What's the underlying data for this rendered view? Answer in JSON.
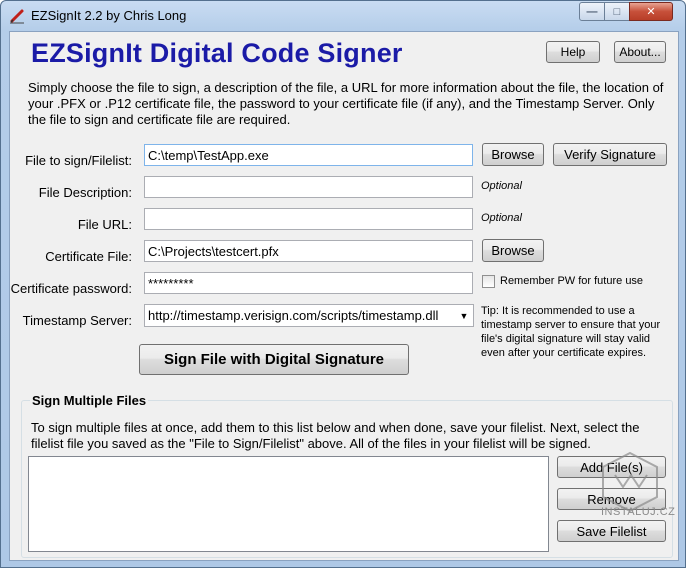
{
  "window": {
    "title": "EZSignIt 2.2 by Chris Long",
    "minimize_glyph": "—",
    "maximize_glyph": "□",
    "close_glyph": "✕"
  },
  "header": {
    "app_title": "EZSignIt Digital Code Signer",
    "help_label": "Help",
    "about_label": "About..."
  },
  "intro": "Simply choose the file to sign, a description of the file, a URL for more information about the file, the location of your .PFX or .P12 certificate file, the password to your certificate file (if any), and the Timestamp Server. Only the file to sign and certificate file are required.",
  "form": {
    "file_to_sign": {
      "label": "File to sign/Filelist:",
      "value": "C:\\temp\\TestApp.exe"
    },
    "browse_label": "Browse",
    "verify_label": "Verify Signature",
    "description": {
      "label": "File Description:",
      "value": "",
      "hint": "Optional"
    },
    "url": {
      "label": "File URL:",
      "value": "",
      "hint": "Optional"
    },
    "certificate": {
      "label": "Certificate File:",
      "value": "C:\\Projects\\testcert.pfx",
      "browse_label": "Browse"
    },
    "password": {
      "label": "Certificate password:",
      "value": "*********"
    },
    "remember_label": "Remember PW for future use",
    "remember_checked": false,
    "timestamp": {
      "label": "Timestamp Server:",
      "value": "http://timestamp.verisign.com/scripts/timestamp.dll"
    },
    "tip": "Tip: It is recommended to use a timestamp server to ensure that your file's digital signature will stay valid even after your certificate expires.",
    "sign_label": "Sign File with Digital Signature"
  },
  "multiple": {
    "title": "Sign Multiple Files",
    "text": "To sign multiple files at once, add them to this list below and when done, save your filelist. Next, select the filelist file you saved as the \"File to Sign/Filelist\" above. All of the files in your filelist will be signed.",
    "add_label": "Add File(s)",
    "remove_label": "Remove",
    "save_label": "Save Filelist",
    "items": []
  },
  "watermark": {
    "text": "INSTALUJ.CZ"
  },
  "colors": {
    "title_blue": "#1b1ba7",
    "client_bg": "#f0f0f0"
  }
}
